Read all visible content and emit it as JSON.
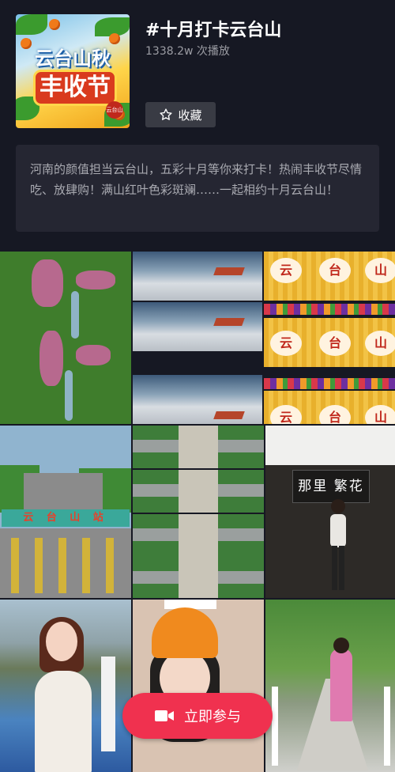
{
  "cover": {
    "line1": "云台山秋",
    "line2": "丰收节",
    "seal": "云台山"
  },
  "topic": {
    "title": "#十月打卡云台山",
    "plays": "1338.2w 次播放",
    "favorite_label": "收藏",
    "description": "河南的颜值担当云台山，五彩十月等你来打卡！热闹丰收节尽情吃、放肆购！满山红叶色彩斑斓……一起相约十月云台山！"
  },
  "videos": [
    {
      "name": "canyon",
      "text": ""
    },
    {
      "name": "sea-of-clouds",
      "text": ""
    },
    {
      "name": "flower-field",
      "text": "云 台 山"
    },
    {
      "name": "toll-gate",
      "text": "云 台 山 站"
    },
    {
      "name": "drone-view",
      "text": ""
    },
    {
      "name": "shop-sign",
      "text": "那里 繁花"
    },
    {
      "name": "girl-on-bridge",
      "text": ""
    },
    {
      "name": "selfie",
      "text": ""
    },
    {
      "name": "mountain-bridge",
      "text": ""
    }
  ],
  "join_button": {
    "label": "立即参与",
    "icon": "video-camera-icon"
  },
  "colors": {
    "background": "#161823",
    "accent": "#f0314f"
  }
}
